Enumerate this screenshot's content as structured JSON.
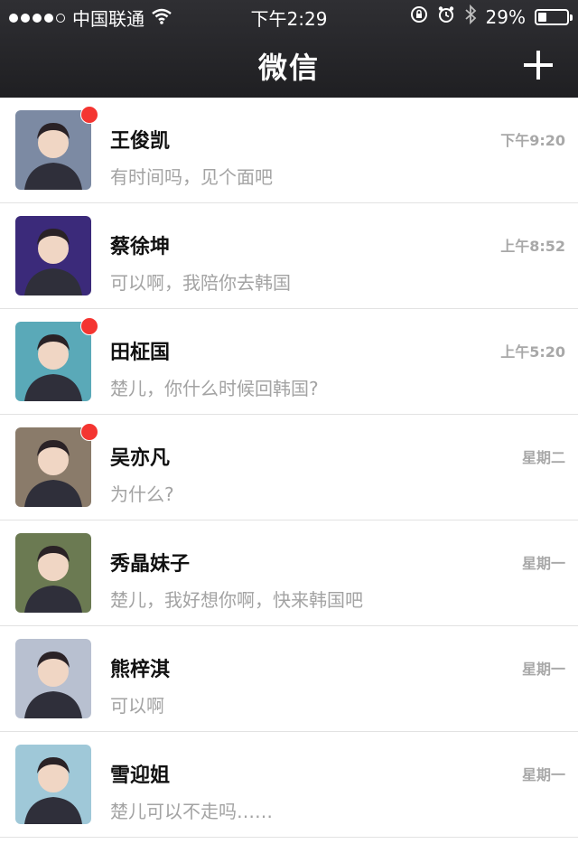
{
  "status_bar": {
    "carrier": "中国联通",
    "time": "下午2:29",
    "battery_percent": "29%",
    "battery_level": 0.29,
    "icons": [
      "signal-dots-icon",
      "wifi-icon",
      "rotation-lock-icon",
      "alarm-icon",
      "bluetooth-icon",
      "battery-icon"
    ]
  },
  "header": {
    "title": "微信",
    "add_icon": "plus-icon"
  },
  "chats": [
    {
      "name": "王俊凯",
      "message": "有时间吗，见个面吧",
      "time": "下午9:20",
      "unread": true,
      "avatar_color": "#7c8aa3"
    },
    {
      "name": "蔡徐坤",
      "message": "可以啊，我陪你去韩国",
      "time": "上午8:52",
      "unread": false,
      "avatar_color": "#3b2a7a"
    },
    {
      "name": "田柾国",
      "message": "楚儿，你什么时候回韩国?",
      "time": "上午5:20",
      "unread": true,
      "avatar_color": "#5aa9b8"
    },
    {
      "name": "吴亦凡",
      "message": "为什么?",
      "time": "星期二",
      "unread": true,
      "avatar_color": "#8a7b6a"
    },
    {
      "name": "秀晶妹子",
      "message": "楚儿，我好想你啊，快来韩国吧",
      "time": "星期一",
      "unread": false,
      "avatar_color": "#6b7a52"
    },
    {
      "name": "熊梓淇",
      "message": "可以啊",
      "time": "星期一",
      "unread": false,
      "avatar_color": "#b8c0d0"
    },
    {
      "name": "雪迎姐",
      "message": "楚儿可以不走吗……",
      "time": "星期一",
      "unread": false,
      "avatar_color": "#9fc8d8"
    }
  ]
}
